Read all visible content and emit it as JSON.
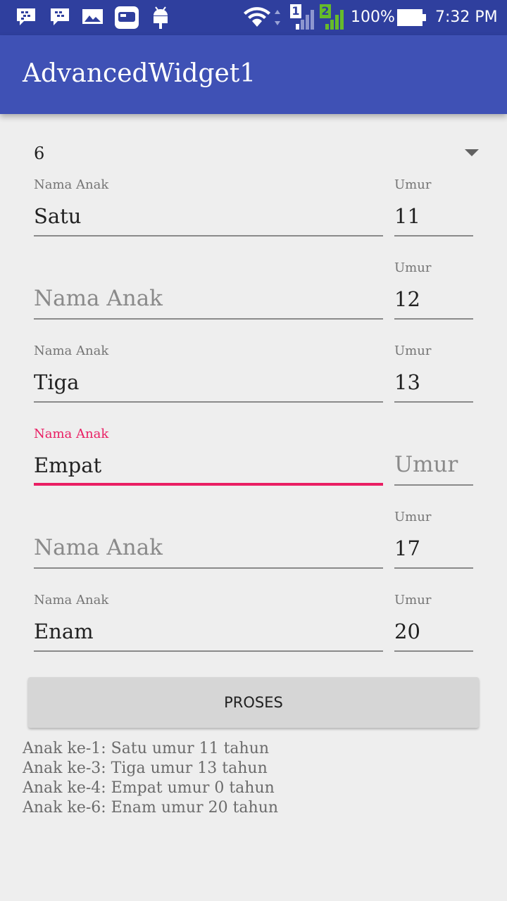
{
  "status_bar": {
    "icons": [
      "bbm-chat-icon",
      "bbm-icon",
      "gallery-icon",
      "game-app-icon",
      "android-debug-icon",
      "wifi-icon",
      "signal-sim1-icon",
      "signal-sim2-icon",
      "battery-icon"
    ],
    "sim1": "1",
    "sim2": "2",
    "battery": "100%",
    "time": "7:32 PM"
  },
  "app": {
    "title": "AdvancedWidget1"
  },
  "spinner": {
    "value": "6",
    "icon": "dropdown-arrow-icon"
  },
  "form": {
    "name_label": "Nama Anak",
    "age_label": "Umur",
    "rows": [
      {
        "name": "Satu",
        "age": "11"
      },
      {
        "name": "",
        "age": "12"
      },
      {
        "name": "Tiga",
        "age": "13"
      },
      {
        "name": "Empat",
        "age": "",
        "focused": true
      },
      {
        "name": "",
        "age": "17"
      },
      {
        "name": "Enam",
        "age": "20"
      }
    ]
  },
  "button": {
    "label": "PROSES"
  },
  "results": [
    "Anak ke-1: Satu umur 11 tahun",
    "Anak ke-3: Tiga umur 13 tahun",
    "Anak ke-4: Empat umur 0 tahun",
    "Anak ke-6: Enam umur 20 tahun"
  ],
  "colors": {
    "primary": "#3f51b5",
    "primary_dark": "#2f3f9e",
    "accent": "#e91e63"
  }
}
